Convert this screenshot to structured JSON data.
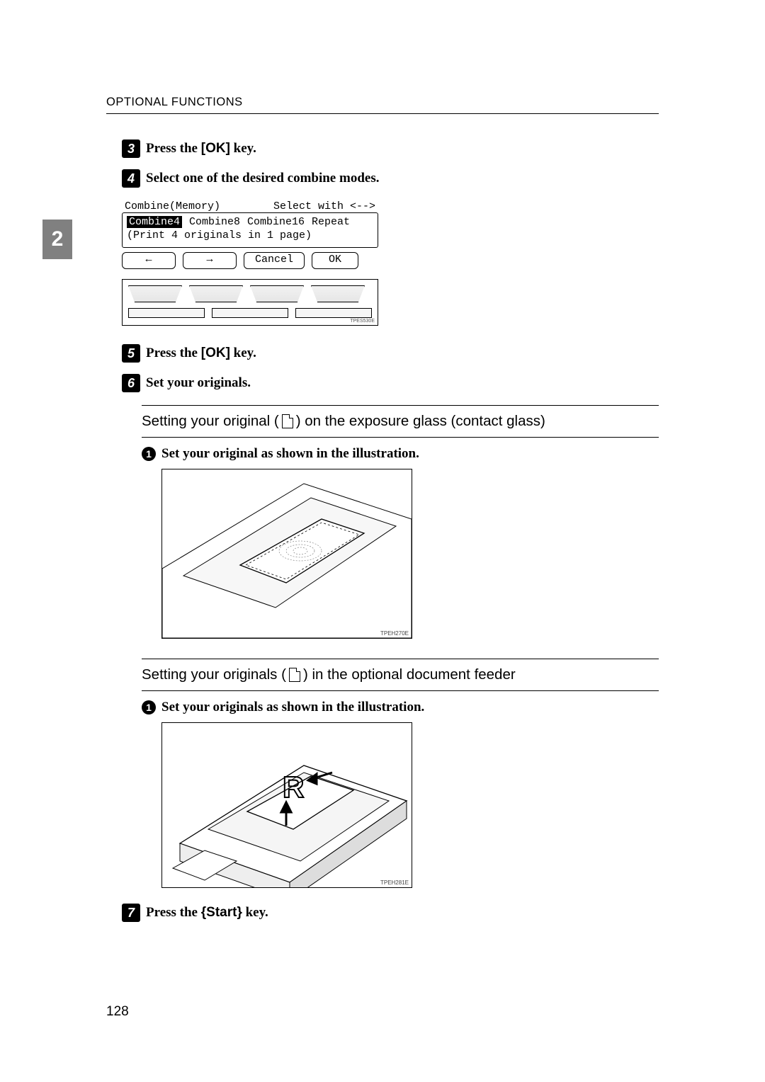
{
  "running_head": "OPTIONAL FUNCTIONS",
  "side_tab": "2",
  "steps": {
    "s3": {
      "num": "3",
      "pre": "Press the ",
      "lb": "[",
      "key": "OK",
      "rb": "]",
      "post": " key."
    },
    "s4": {
      "num": "4",
      "text": "Select one of the desired combine modes."
    },
    "s5": {
      "num": "5",
      "pre": "Press the ",
      "lb": "[",
      "key": "OK",
      "rb": "]",
      "post": " key."
    },
    "s6": {
      "num": "6",
      "text": "Set your originals."
    },
    "s7": {
      "num": "7",
      "pre": "Press the ",
      "lb": "{",
      "key": "Start",
      "rb": "}",
      "post": " key."
    }
  },
  "lcd": {
    "title_left": "Combine(Memory)",
    "title_right": "Select with <-->",
    "opt1": "Combine4",
    "opt2": "Combine8",
    "opt3": "Combine16",
    "opt4": "Repeat",
    "desc": "(Print 4 originals in 1 page)",
    "soft1": "←",
    "soft2": "→",
    "soft3": "Cancel",
    "soft4": "OK"
  },
  "panel_label": "TPES530E",
  "sub1": {
    "pre": "Setting your original (",
    "post": ") on the exposure glass (contact glass)"
  },
  "sub2": {
    "pre": "Setting your originals (",
    "post": ") in the optional document feeder"
  },
  "substep_a": {
    "num": "1",
    "text": "Set your original as shown in the illustration."
  },
  "substep_b": {
    "num": "1",
    "text": "Set your originals as shown in the illustration."
  },
  "illus1_label": "TPEH270E",
  "illus2_label": "TPEH281E",
  "page_number": "128"
}
